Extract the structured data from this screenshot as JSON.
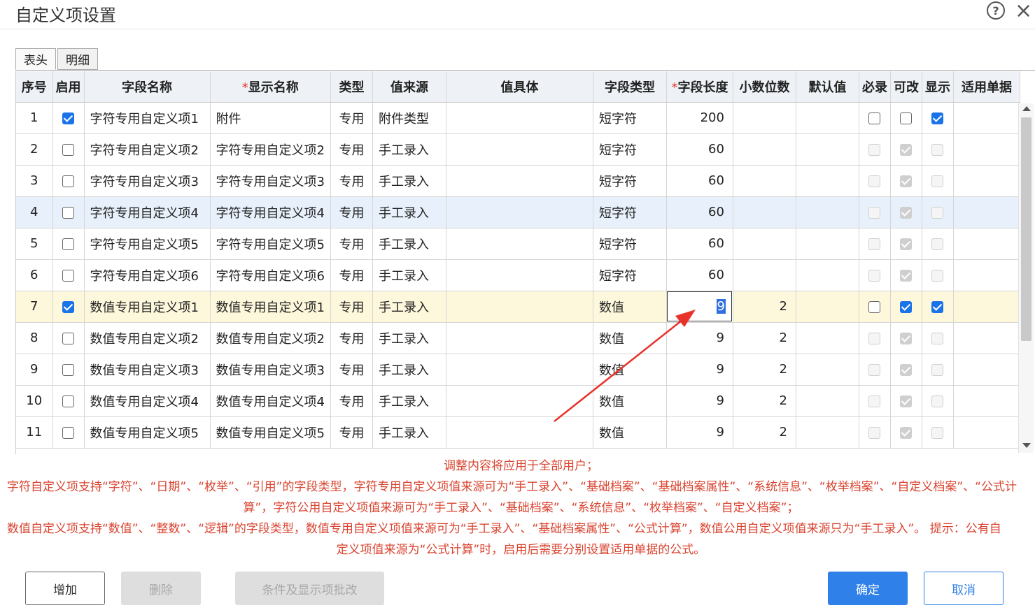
{
  "window": {
    "title": "自定义项设置",
    "help_icon": "?",
    "close_icon": "×"
  },
  "tabs": [
    {
      "label": "表头",
      "active": true
    },
    {
      "label": "明细",
      "active": false
    }
  ],
  "columns": [
    {
      "label": "序号",
      "required": false
    },
    {
      "label": "启用",
      "required": false
    },
    {
      "label": "字段名称",
      "required": false
    },
    {
      "label": "显示名称",
      "required": true
    },
    {
      "label": "类型",
      "required": false
    },
    {
      "label": "值来源",
      "required": false
    },
    {
      "label": "值具体",
      "required": false
    },
    {
      "label": "字段类型",
      "required": false
    },
    {
      "label": "字段长度",
      "required": true
    },
    {
      "label": "小数位数",
      "required": false
    },
    {
      "label": "默认值",
      "required": false
    },
    {
      "label": "必录",
      "required": false
    },
    {
      "label": "可改",
      "required": false
    },
    {
      "label": "显示",
      "required": false
    },
    {
      "label": "适用单据",
      "required": false
    }
  ],
  "required_mark": "*",
  "rows": [
    {
      "seq": "1",
      "enabled": true,
      "field_name": "字符专用自定义项1",
      "display_name": "附件",
      "type": "专用",
      "value_source": "附件类型",
      "value_detail": "",
      "field_type": "短字符",
      "length": "200",
      "decimals": "",
      "default": "",
      "required": false,
      "editable": false,
      "visible": true,
      "flags_disabled": false
    },
    {
      "seq": "2",
      "enabled": false,
      "field_name": "字符专用自定义项2",
      "display_name": "字符专用自定义项2",
      "type": "专用",
      "value_source": "手工录入",
      "value_detail": "",
      "field_type": "短字符",
      "length": "60",
      "decimals": "",
      "default": "",
      "required": false,
      "editable": true,
      "visible": false,
      "flags_disabled": true
    },
    {
      "seq": "3",
      "enabled": false,
      "field_name": "字符专用自定义项3",
      "display_name": "字符专用自定义项3",
      "type": "专用",
      "value_source": "手工录入",
      "value_detail": "",
      "field_type": "短字符",
      "length": "60",
      "decimals": "",
      "default": "",
      "required": false,
      "editable": true,
      "visible": false,
      "flags_disabled": true
    },
    {
      "seq": "4",
      "enabled": false,
      "field_name": "字符专用自定义项4",
      "display_name": "字符专用自定义项4",
      "type": "专用",
      "value_source": "手工录入",
      "value_detail": "",
      "field_type": "短字符",
      "length": "60",
      "decimals": "",
      "default": "",
      "required": false,
      "editable": true,
      "visible": false,
      "flags_disabled": true
    },
    {
      "seq": "5",
      "enabled": false,
      "field_name": "字符专用自定义项5",
      "display_name": "字符专用自定义项5",
      "type": "专用",
      "value_source": "手工录入",
      "value_detail": "",
      "field_type": "短字符",
      "length": "60",
      "decimals": "",
      "default": "",
      "required": false,
      "editable": true,
      "visible": false,
      "flags_disabled": true
    },
    {
      "seq": "6",
      "enabled": false,
      "field_name": "字符专用自定义项6",
      "display_name": "字符专用自定义项6",
      "type": "专用",
      "value_source": "手工录入",
      "value_detail": "",
      "field_type": "短字符",
      "length": "60",
      "decimals": "",
      "default": "",
      "required": false,
      "editable": true,
      "visible": false,
      "flags_disabled": true
    },
    {
      "seq": "7",
      "enabled": true,
      "field_name": "数值专用自定义项1",
      "display_name": "数值专用自定义项1",
      "type": "专用",
      "value_source": "手工录入",
      "value_detail": "",
      "field_type": "数值",
      "length": "9",
      "decimals": "2",
      "default": "",
      "required": false,
      "editable": true,
      "visible": true,
      "flags_disabled": false
    },
    {
      "seq": "8",
      "enabled": false,
      "field_name": "数值专用自定义项2",
      "display_name": "数值专用自定义项2",
      "type": "专用",
      "value_source": "手工录入",
      "value_detail": "",
      "field_type": "数值",
      "length": "9",
      "decimals": "2",
      "default": "",
      "required": false,
      "editable": true,
      "visible": false,
      "flags_disabled": true
    },
    {
      "seq": "9",
      "enabled": false,
      "field_name": "数值专用自定义项3",
      "display_name": "数值专用自定义项3",
      "type": "专用",
      "value_source": "手工录入",
      "value_detail": "",
      "field_type": "数值",
      "length": "9",
      "decimals": "2",
      "default": "",
      "required": false,
      "editable": true,
      "visible": false,
      "flags_disabled": true
    },
    {
      "seq": "10",
      "enabled": false,
      "field_name": "数值专用自定义项4",
      "display_name": "数值专用自定义项4",
      "type": "专用",
      "value_source": "手工录入",
      "value_detail": "",
      "field_type": "数值",
      "length": "9",
      "decimals": "2",
      "default": "",
      "required": false,
      "editable": true,
      "visible": false,
      "flags_disabled": true
    },
    {
      "seq": "11",
      "enabled": false,
      "field_name": "数值专用自定义项5",
      "display_name": "数值专用自定义项5",
      "type": "专用",
      "value_source": "手工录入",
      "value_detail": "",
      "field_type": "数值",
      "length": "9",
      "decimals": "2",
      "default": "",
      "required": false,
      "editable": true,
      "visible": false,
      "flags_disabled": true
    }
  ],
  "highlight_row": "4",
  "editing_row": "7",
  "notes": {
    "line1": "调整内容将应用于全部用户；",
    "line2": "字符自定义项支持“字符”、“日期”、“枚举”、“引用”的字段类型，字符专用自定义项值来源可为“手工录入”、“基础档案”、“基础档案属性”、“系统信息”、“枚举档案”、“自定义档案”、“公式计",
    "line3": "算”，字符公用自定义项值来源可为“手工录入”、“基础档案”、“系统信息”、“枚举档案”、“自定义档案”；",
    "line4": "数值自定义项支持“数值”、“整数”、“逻辑”的字段类型，数值专用自定义项值来源可为“手工录入”、“基础档案属性”、“公式计算”，数值公用自定义项值来源只为“手工录入”。 提示：公有自",
    "line5": "定义项值来源为“公式计算”时，启用后需要分别设置适用单据的公式。"
  },
  "buttons": {
    "add": "增加",
    "delete": "删除",
    "batch_edit": "条件及显示项批改",
    "ok": "确定",
    "cancel": "取消"
  },
  "colors": {
    "accent": "#2f80e8",
    "checkbox_on": "#1a73e8",
    "note_text": "#d9432f",
    "annotation_arrow": "#e8322a",
    "highlight_row_bg": "#e8f1fb",
    "editing_row_bg": "#fdf7dc"
  }
}
